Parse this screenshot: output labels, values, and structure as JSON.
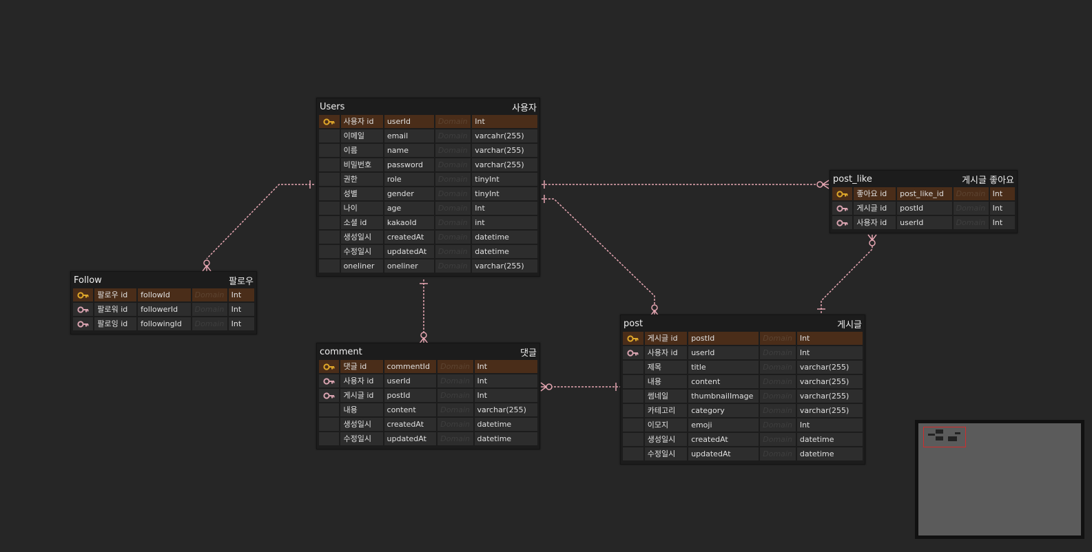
{
  "colors": {
    "background": "#262626",
    "table_bg": "#1c1c1c",
    "cell_bg": "#2d2d2d",
    "pk_row_bg": "#4a2d19",
    "pk_key": "#e0a82a",
    "fk_key": "#d9a3b0",
    "relation_line": "#e6a6b2",
    "minimap_view": "#d22c2c"
  },
  "tables": {
    "users": {
      "name": "Users",
      "logical": "사용자",
      "rows": [
        {
          "key": "pk",
          "logical": "사용자 id",
          "physical": "userId",
          "domain": "Domain",
          "type": "Int"
        },
        {
          "key": "",
          "logical": "이메일",
          "physical": "email",
          "domain": "Domain",
          "type": "varcahr(255)"
        },
        {
          "key": "",
          "logical": "이름",
          "physical": "name",
          "domain": "Domain",
          "type": "varchar(255)"
        },
        {
          "key": "",
          "logical": "비밀번호",
          "physical": "password",
          "domain": "Domain",
          "type": "varchar(255)"
        },
        {
          "key": "",
          "logical": "권한",
          "physical": "role",
          "domain": "Domain",
          "type": "tinyInt"
        },
        {
          "key": "",
          "logical": "성별",
          "physical": "gender",
          "domain": "Domain",
          "type": "tinyInt"
        },
        {
          "key": "",
          "logical": "나이",
          "physical": "age",
          "domain": "Domain",
          "type": "Int"
        },
        {
          "key": "",
          "logical": "소셜 id",
          "physical": "kakaoId",
          "domain": "Domain",
          "type": "int"
        },
        {
          "key": "",
          "logical": "생성일시",
          "physical": "createdAt",
          "domain": "Domain",
          "type": "datetime"
        },
        {
          "key": "",
          "logical": "수정일시",
          "physical": "updatedAt",
          "domain": "Domain",
          "type": "datetime"
        },
        {
          "key": "",
          "logical": "oneliner",
          "physical": "oneliner",
          "domain": "Domain",
          "type": "varchar(255)"
        }
      ]
    },
    "follow": {
      "name": "Follow",
      "logical": "팔로우",
      "rows": [
        {
          "key": "pk",
          "logical": "팔로우 id",
          "physical": "followId",
          "domain": "Domain",
          "type": "Int"
        },
        {
          "key": "fk",
          "logical": "팔로워 id",
          "physical": "followerId",
          "domain": "Domain",
          "type": "Int"
        },
        {
          "key": "fk",
          "logical": "팔로잉 id",
          "physical": "followingId",
          "domain": "Domain",
          "type": "Int"
        }
      ]
    },
    "comment": {
      "name": "comment",
      "logical": "댓글",
      "rows": [
        {
          "key": "pk",
          "logical": "댓글 id",
          "physical": "commentId",
          "domain": "Domain",
          "type": "Int"
        },
        {
          "key": "fk",
          "logical": "사용자 id",
          "physical": "userId",
          "domain": "Domain",
          "type": "Int"
        },
        {
          "key": "fk",
          "logical": "게시글 id",
          "physical": "postId",
          "domain": "Domain",
          "type": "Int"
        },
        {
          "key": "",
          "logical": "내용",
          "physical": "content",
          "domain": "Domain",
          "type": "varchar(255)"
        },
        {
          "key": "",
          "logical": "생성일시",
          "physical": "createdAt",
          "domain": "Domain",
          "type": "datetime"
        },
        {
          "key": "",
          "logical": "수정일시",
          "physical": "updatedAt",
          "domain": "Domain",
          "type": "datetime"
        }
      ]
    },
    "post_like": {
      "name": "post_like",
      "logical": "게시글 좋아요",
      "rows": [
        {
          "key": "pk",
          "logical": "좋아요 id",
          "physical": "post_like_id",
          "domain": "Domain",
          "type": "Int"
        },
        {
          "key": "fk",
          "logical": "게시글 id",
          "physical": "postId",
          "domain": "Domain",
          "type": "Int"
        },
        {
          "key": "fk",
          "logical": "사용자 id",
          "physical": "userId",
          "domain": "Domain",
          "type": "Int"
        }
      ]
    },
    "post": {
      "name": "post",
      "logical": "게시글",
      "rows": [
        {
          "key": "pk",
          "logical": "게시글 id",
          "physical": "postId",
          "domain": "Domain",
          "type": "Int"
        },
        {
          "key": "fk",
          "logical": "사용자 id",
          "physical": "userId",
          "domain": "Domain",
          "type": "Int"
        },
        {
          "key": "",
          "logical": "제목",
          "physical": "title",
          "domain": "Domain",
          "type": "varchar(255)"
        },
        {
          "key": "",
          "logical": "내용",
          "physical": "content",
          "domain": "Domain",
          "type": "varchar(255)"
        },
        {
          "key": "",
          "logical": "썸네일",
          "physical": "thumbnailImage",
          "domain": "Domain",
          "type": "varchar(255)"
        },
        {
          "key": "",
          "logical": "카테고리",
          "physical": "category",
          "domain": "Domain",
          "type": "varchar(255)"
        },
        {
          "key": "",
          "logical": "이모지",
          "physical": "emoji",
          "domain": "Domain",
          "type": "Int"
        },
        {
          "key": "",
          "logical": "생성일시",
          "physical": "createdAt",
          "domain": "Domain",
          "type": "datetime"
        },
        {
          "key": "",
          "logical": "수정일시",
          "physical": "updatedAt",
          "domain": "Domain",
          "type": "datetime"
        }
      ]
    }
  },
  "relations": [
    {
      "from": "users",
      "to": "follow",
      "label": ""
    },
    {
      "from": "users",
      "to": "post_like",
      "label": ""
    },
    {
      "from": "users",
      "to": "post",
      "label": ""
    },
    {
      "from": "users",
      "to": "comment",
      "label": ""
    },
    {
      "from": "post",
      "to": "comment",
      "label": ""
    },
    {
      "from": "post",
      "to": "post_like",
      "label": ""
    }
  ]
}
